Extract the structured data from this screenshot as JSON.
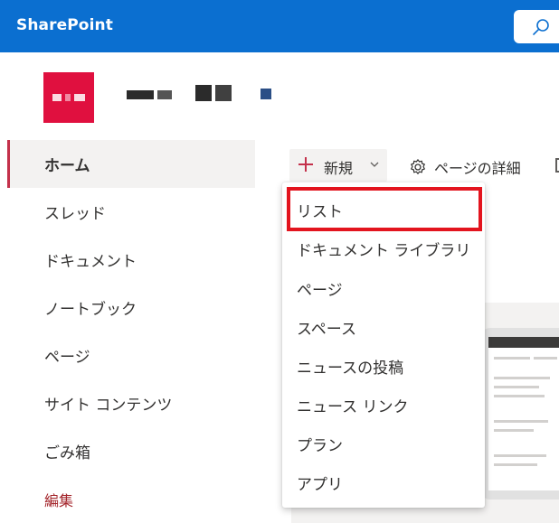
{
  "app": {
    "brand": "SharePoint"
  },
  "header": {
    "search_icon": "search-icon"
  },
  "site": {
    "logo_icon": "site-logo-icon",
    "title_icon": "site-title-pixelated"
  },
  "nav": {
    "items": [
      {
        "label": "ホーム",
        "active": true
      },
      {
        "label": "スレッド"
      },
      {
        "label": "ドキュメント"
      },
      {
        "label": "ノートブック"
      },
      {
        "label": "ページ"
      },
      {
        "label": "サイト コンテンツ"
      },
      {
        "label": "ごみ箱"
      }
    ],
    "edit_label": "編集"
  },
  "commandbar": {
    "new_label": "新規",
    "page_details_label": "ページの詳細"
  },
  "new_menu": {
    "items": [
      {
        "label": "リスト",
        "highlighted": true
      },
      {
        "label": "ドキュメント ライブラリ"
      },
      {
        "label": "ページ"
      },
      {
        "label": "スペース"
      },
      {
        "label": "ニュースの投稿"
      },
      {
        "label": "ニュース リンク"
      },
      {
        "label": "プラン"
      },
      {
        "label": "アプリ"
      }
    ]
  },
  "colors": {
    "suite_bar": "#0b6fd0",
    "accent": "#c4314b",
    "highlight_border": "#e3141e",
    "site_logo": "#e0103f"
  }
}
